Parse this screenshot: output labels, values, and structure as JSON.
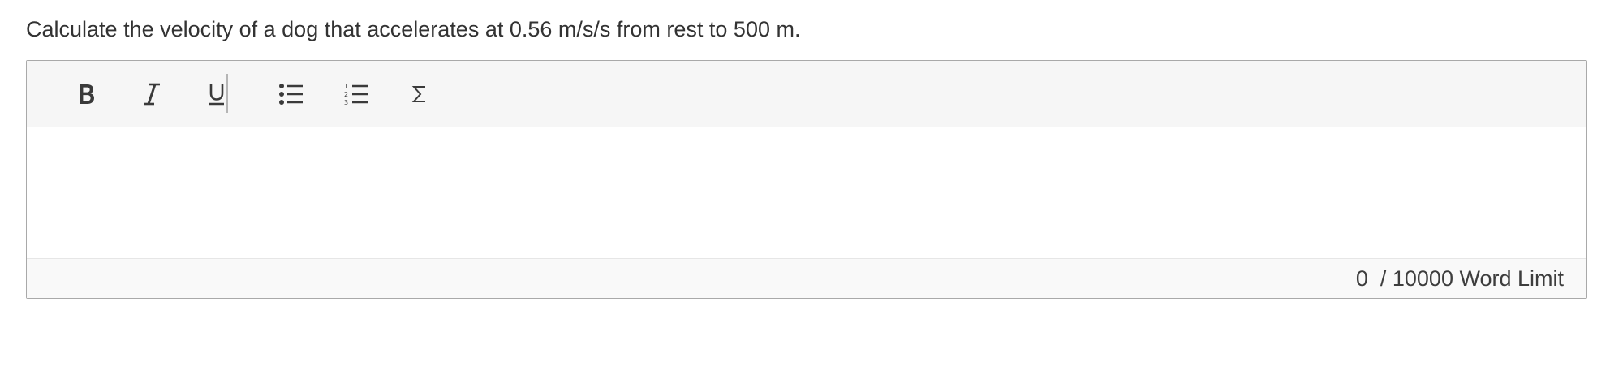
{
  "question": {
    "text": "Calculate the velocity of a dog that accelerates at 0.56 m/s/s from rest to 500 m."
  },
  "editor": {
    "toolbar": [
      {
        "name": "bold",
        "icon": "bold-icon"
      },
      {
        "name": "italic",
        "icon": "italic-icon"
      },
      {
        "name": "underline",
        "icon": "underline-icon"
      },
      {
        "name": "bulleted-list",
        "icon": "bulleted-list-icon"
      },
      {
        "name": "numbered-list",
        "icon": "numbered-list-icon"
      },
      {
        "name": "equation",
        "icon": "sigma-icon"
      }
    ],
    "content": "",
    "word_count": {
      "text": "0  / 10000 Word Limit"
    }
  },
  "colors": {
    "toolbar_bg": "#f6f6f6",
    "footer_bg": "#f9f9f9",
    "border": "#a9a9a9",
    "text": "#333333"
  }
}
